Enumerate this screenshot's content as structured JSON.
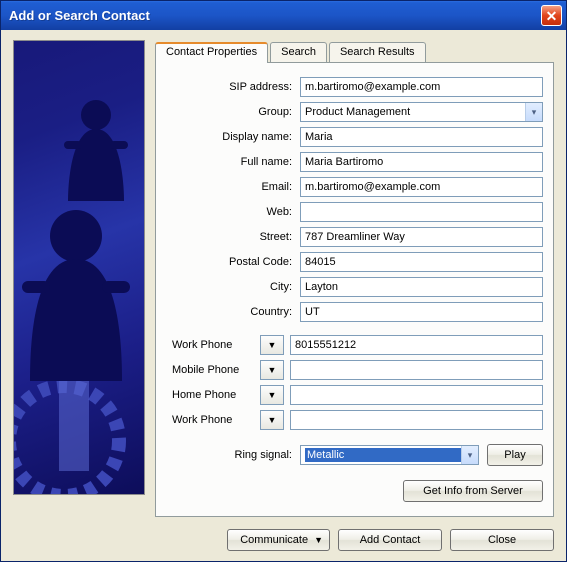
{
  "window": {
    "title": "Add or Search Contact"
  },
  "tabs": {
    "contact_properties": "Contact Properties",
    "search": "Search",
    "search_results": "Search Results"
  },
  "labels": {
    "sip": "SIP address:",
    "group": "Group:",
    "display_name": "Display name:",
    "full_name": "Full name:",
    "email": "Email:",
    "web": "Web:",
    "street": "Street:",
    "postal": "Postal Code:",
    "city": "City:",
    "country": "Country:",
    "ring": "Ring signal:"
  },
  "values": {
    "sip": "m.bartiromo@example.com",
    "group": "Product Management",
    "display_name": "Maria",
    "full_name": "Maria Bartiromo",
    "email": "m.bartiromo@example.com",
    "web": "",
    "street": "787 Dreamliner Way",
    "postal": "84015",
    "city": "Layton",
    "country": "UT",
    "ring": "Metallic"
  },
  "phones": [
    {
      "label": "Work Phone",
      "value": "8015551212"
    },
    {
      "label": "Mobile Phone",
      "value": ""
    },
    {
      "label": "Home Phone",
      "value": ""
    },
    {
      "label": "Work Phone",
      "value": ""
    }
  ],
  "buttons": {
    "play": "Play",
    "get_info": "Get Info from Server",
    "communicate": "Communicate",
    "add_contact": "Add Contact",
    "close": "Close"
  }
}
